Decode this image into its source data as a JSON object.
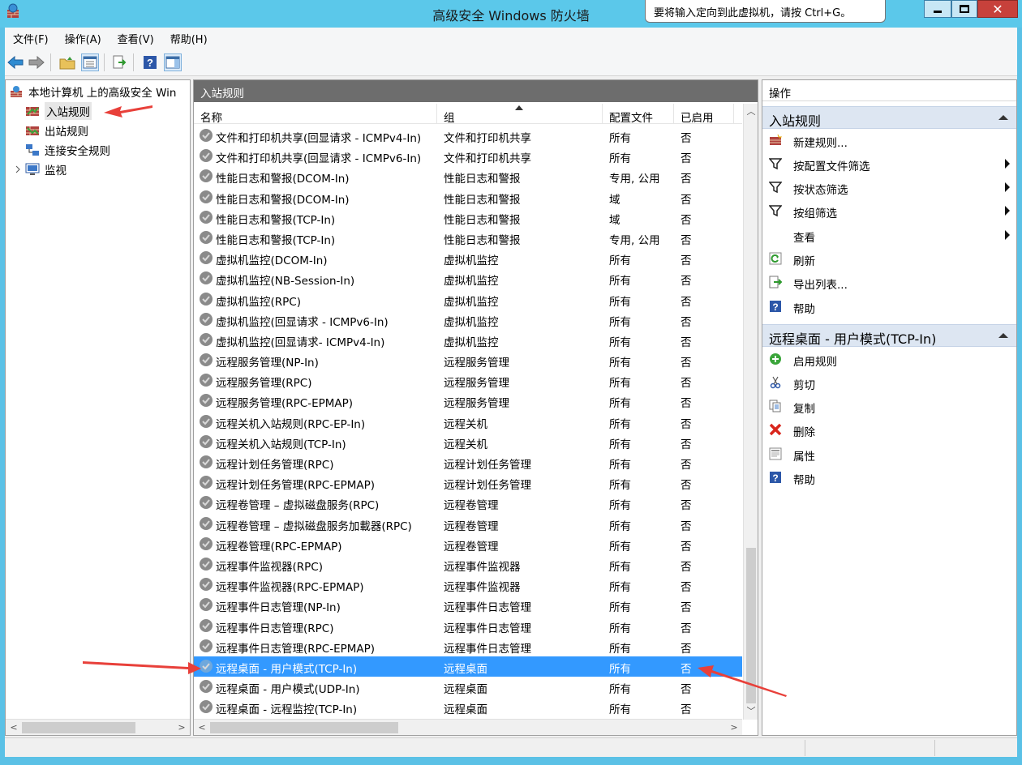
{
  "window": {
    "title": "高级安全 Windows 防火墙",
    "tooltip": "要将输入定向到此虚拟机，请按 Ctrl+G。",
    "close_glyph": "✕"
  },
  "menu": [
    "文件(F)",
    "操作(A)",
    "查看(V)",
    "帮助(H)"
  ],
  "tree": {
    "root": "本地计算机 上的高级安全 Win",
    "items": [
      "入站规则",
      "出站规则",
      "连接安全规则",
      "监视"
    ]
  },
  "center": {
    "header": "入站规则",
    "columns": {
      "name": "名称",
      "group": "组",
      "profile": "配置文件",
      "enabled": "已启用"
    },
    "rows": [
      {
        "name": "文件和打印机共享(回显请求 - ICMPv4-In)",
        "group": "文件和打印机共享",
        "profile": "所有",
        "enabled": "否"
      },
      {
        "name": "文件和打印机共享(回显请求 - ICMPv6-In)",
        "group": "文件和打印机共享",
        "profile": "所有",
        "enabled": "否"
      },
      {
        "name": "性能日志和警报(DCOM-In)",
        "group": "性能日志和警报",
        "profile": "专用, 公用",
        "enabled": "否"
      },
      {
        "name": "性能日志和警报(DCOM-In)",
        "group": "性能日志和警报",
        "profile": "域",
        "enabled": "否"
      },
      {
        "name": "性能日志和警报(TCP-In)",
        "group": "性能日志和警报",
        "profile": "域",
        "enabled": "否"
      },
      {
        "name": "性能日志和警报(TCP-In)",
        "group": "性能日志和警报",
        "profile": "专用, 公用",
        "enabled": "否"
      },
      {
        "name": "虚拟机监控(DCOM-In)",
        "group": "虚拟机监控",
        "profile": "所有",
        "enabled": "否"
      },
      {
        "name": "虚拟机监控(NB-Session-In)",
        "group": "虚拟机监控",
        "profile": "所有",
        "enabled": "否"
      },
      {
        "name": "虚拟机监控(RPC)",
        "group": "虚拟机监控",
        "profile": "所有",
        "enabled": "否"
      },
      {
        "name": "虚拟机监控(回显请求 - ICMPv6-In)",
        "group": "虚拟机监控",
        "profile": "所有",
        "enabled": "否"
      },
      {
        "name": "虚拟机监控(回显请求- ICMPv4-In)",
        "group": "虚拟机监控",
        "profile": "所有",
        "enabled": "否"
      },
      {
        "name": "远程服务管理(NP-In)",
        "group": "远程服务管理",
        "profile": "所有",
        "enabled": "否"
      },
      {
        "name": "远程服务管理(RPC)",
        "group": "远程服务管理",
        "profile": "所有",
        "enabled": "否"
      },
      {
        "name": "远程服务管理(RPC-EPMAP)",
        "group": "远程服务管理",
        "profile": "所有",
        "enabled": "否"
      },
      {
        "name": "远程关机入站规则(RPC-EP-In)",
        "group": "远程关机",
        "profile": "所有",
        "enabled": "否"
      },
      {
        "name": "远程关机入站规则(TCP-In)",
        "group": "远程关机",
        "profile": "所有",
        "enabled": "否"
      },
      {
        "name": "远程计划任务管理(RPC)",
        "group": "远程计划任务管理",
        "profile": "所有",
        "enabled": "否"
      },
      {
        "name": "远程计划任务管理(RPC-EPMAP)",
        "group": "远程计划任务管理",
        "profile": "所有",
        "enabled": "否"
      },
      {
        "name": "远程卷管理 – 虚拟磁盘服务(RPC)",
        "group": "远程卷管理",
        "profile": "所有",
        "enabled": "否"
      },
      {
        "name": "远程卷管理 – 虚拟磁盘服务加載器(RPC)",
        "group": "远程卷管理",
        "profile": "所有",
        "enabled": "否"
      },
      {
        "name": "远程卷管理(RPC-EPMAP)",
        "group": "远程卷管理",
        "profile": "所有",
        "enabled": "否"
      },
      {
        "name": "远程事件监视器(RPC)",
        "group": "远程事件监视器",
        "profile": "所有",
        "enabled": "否"
      },
      {
        "name": "远程事件监视器(RPC-EPMAP)",
        "group": "远程事件监视器",
        "profile": "所有",
        "enabled": "否"
      },
      {
        "name": "远程事件日志管理(NP-In)",
        "group": "远程事件日志管理",
        "profile": "所有",
        "enabled": "否"
      },
      {
        "name": "远程事件日志管理(RPC)",
        "group": "远程事件日志管理",
        "profile": "所有",
        "enabled": "否"
      },
      {
        "name": "远程事件日志管理(RPC-EPMAP)",
        "group": "远程事件日志管理",
        "profile": "所有",
        "enabled": "否"
      },
      {
        "name": "远程桌面 - 用户模式(TCP-In)",
        "group": "远程桌面",
        "profile": "所有",
        "enabled": "否",
        "selected": true
      },
      {
        "name": "远程桌面 - 用户模式(UDP-In)",
        "group": "远程桌面",
        "profile": "所有",
        "enabled": "否"
      },
      {
        "name": "远程桌面 - 远程监控(TCP-In)",
        "group": "远程桌面",
        "profile": "所有",
        "enabled": "否"
      }
    ]
  },
  "actions": {
    "title": "操作",
    "section1": "入站规则",
    "section1_items": [
      "新建规则...",
      "按配置文件筛选",
      "按状态筛选",
      "按组筛选",
      "查看",
      "刷新",
      "导出列表...",
      "帮助"
    ],
    "section2": "远程桌面 - 用户模式(TCP-In)",
    "section2_items": [
      "启用规则",
      "剪切",
      "复制",
      "删除",
      "属性",
      "帮助"
    ]
  },
  "colors": {
    "titlebar": "#5bc8ea",
    "selection": "#3399ff",
    "pane_header": "#6d6d6d",
    "section_bg": "#dde6f2",
    "annotation_arrow": "#e8403a"
  }
}
